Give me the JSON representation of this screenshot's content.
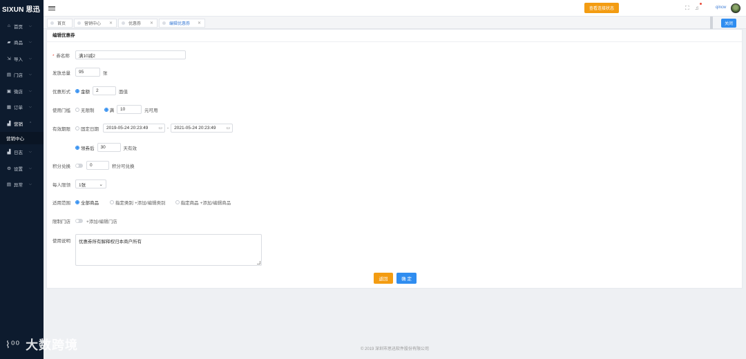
{
  "brand": "SIXUN 思迅",
  "sidebar": {
    "items": [
      {
        "icon": "home-icon",
        "glyph": "⌂",
        "label": "首页"
      },
      {
        "icon": "goods-icon",
        "glyph": "▰",
        "label": "商品"
      },
      {
        "icon": "import-icon",
        "glyph": "⇲",
        "label": "导入"
      },
      {
        "icon": "store-icon",
        "glyph": "▤",
        "label": "门店"
      },
      {
        "icon": "wechat-store-icon",
        "glyph": "▣",
        "label": "微店"
      },
      {
        "icon": "order-icon",
        "glyph": "▦",
        "label": "订单"
      },
      {
        "icon": "marketing-icon",
        "glyph": "▟",
        "label": "营销"
      },
      {
        "icon": "log-icon",
        "glyph": "▟",
        "label": "日志"
      },
      {
        "icon": "settings-icon",
        "glyph": "⚙",
        "label": "设置"
      },
      {
        "icon": "abnormal-icon",
        "glyph": "▤",
        "label": "异常"
      }
    ],
    "submenu_label": "营销中心"
  },
  "header": {
    "check_button": "查看连接状态",
    "user": "qincw"
  },
  "tabs": [
    {
      "label": "首页"
    },
    {
      "label": "营销中心"
    },
    {
      "label": "优惠券"
    },
    {
      "label": "编辑优惠券"
    }
  ],
  "close_label": "关闭",
  "form": {
    "title": "编辑优惠券",
    "name_label": "券名称",
    "name_value": "满10减2",
    "total_label": "发放总量",
    "total_value": "95",
    "total_unit": "张",
    "discount_label": "优惠形式",
    "discount_option": "金额",
    "discount_value": "2",
    "discount_unit": "面值",
    "threshold_label": "使用门槛",
    "threshold_none": "无限制",
    "threshold_full": "满",
    "threshold_value": "10",
    "threshold_unit": "元可用",
    "validity_label": "有效期限",
    "validity_fixed": "固定日期",
    "date_start": "2019-05-24 20:23:49",
    "date_sep": "-",
    "date_end": "2021-05-24 20:23:49",
    "validity_after": "领券后",
    "validity_days": "30",
    "validity_unit": "天有效",
    "points_label": "积分兑换",
    "points_value": "0",
    "points_unit": "积分可兑换",
    "limit_label": "每人限领",
    "limit_value": "1张",
    "scope_label": "适用范围",
    "scope_all": "全部商品",
    "scope_category": "指定类别",
    "scope_category_link": "+添加/编辑类别",
    "scope_goods": "指定商品",
    "scope_goods_link": "+添加/编辑商品",
    "store_label": "限制门店",
    "store_link": "+添加/编辑门店",
    "desc_label": "使用说明",
    "desc_value": "优惠券所有解释权归本商户所有",
    "back_button": "返回",
    "ok_button": "确 定"
  },
  "footer": "© 2019 深圳市思迅软件股份有限公司",
  "watermark": "大数跨境",
  "watermark_logo": "⌇⁰⁰"
}
